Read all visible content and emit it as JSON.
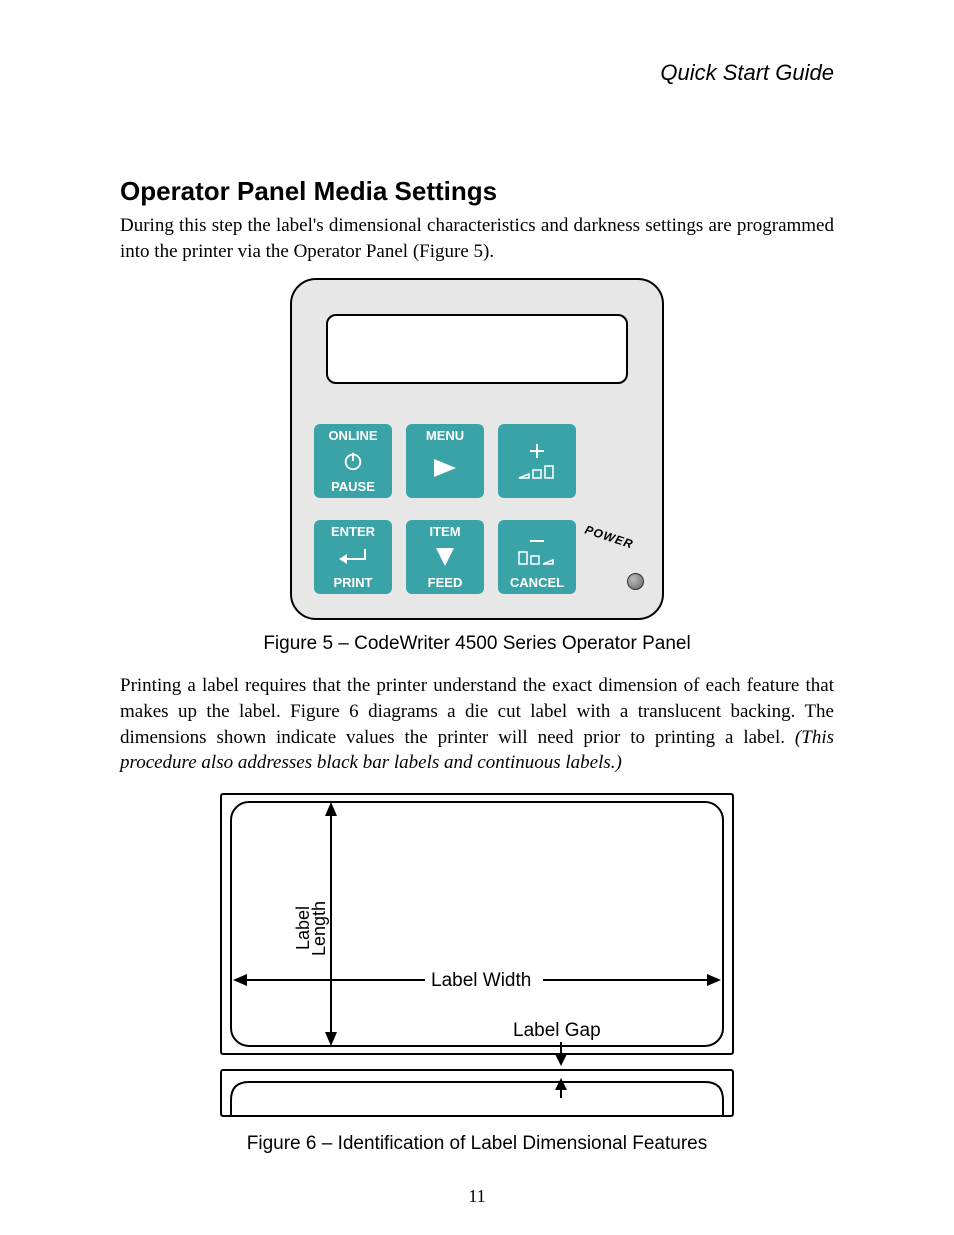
{
  "header": {
    "title": "Quick Start Guide"
  },
  "section": {
    "title": "Operator Panel Media Settings",
    "para1": "During this step the label's dimensional characteristics and darkness settings are programmed into the printer via the Operator Panel (Figure 5).",
    "para2_plain": "Printing a label requires that the printer understand the exact dimension of each feature that makes up the label. Figure 6 diagrams a die cut label with a translucent backing. The dimensions shown indicate values the printer will need prior to printing a label. ",
    "para2_italic": "(This procedure also addresses black bar labels and continuous labels.)"
  },
  "figure5": {
    "caption": "Figure 5 – CodeWriter 4500 Series Operator Panel",
    "buttons": {
      "online": {
        "top": "ONLINE",
        "bottom": "PAUSE"
      },
      "menu": {
        "top": "MENU",
        "bottom": ""
      },
      "plus": {
        "top": "",
        "bottom": ""
      },
      "enter": {
        "top": "ENTER",
        "bottom": "PRINT"
      },
      "item": {
        "top": "ITEM",
        "bottom": "FEED"
      },
      "cancel": {
        "top": "",
        "bottom": "CANCEL"
      }
    },
    "power_label": "POWER"
  },
  "figure6": {
    "caption": "Figure 6 – Identification of Label Dimensional Features",
    "labels": {
      "length": "Label\nLength",
      "width": "Label Width",
      "gap": "Label Gap"
    }
  },
  "page_number": "11"
}
